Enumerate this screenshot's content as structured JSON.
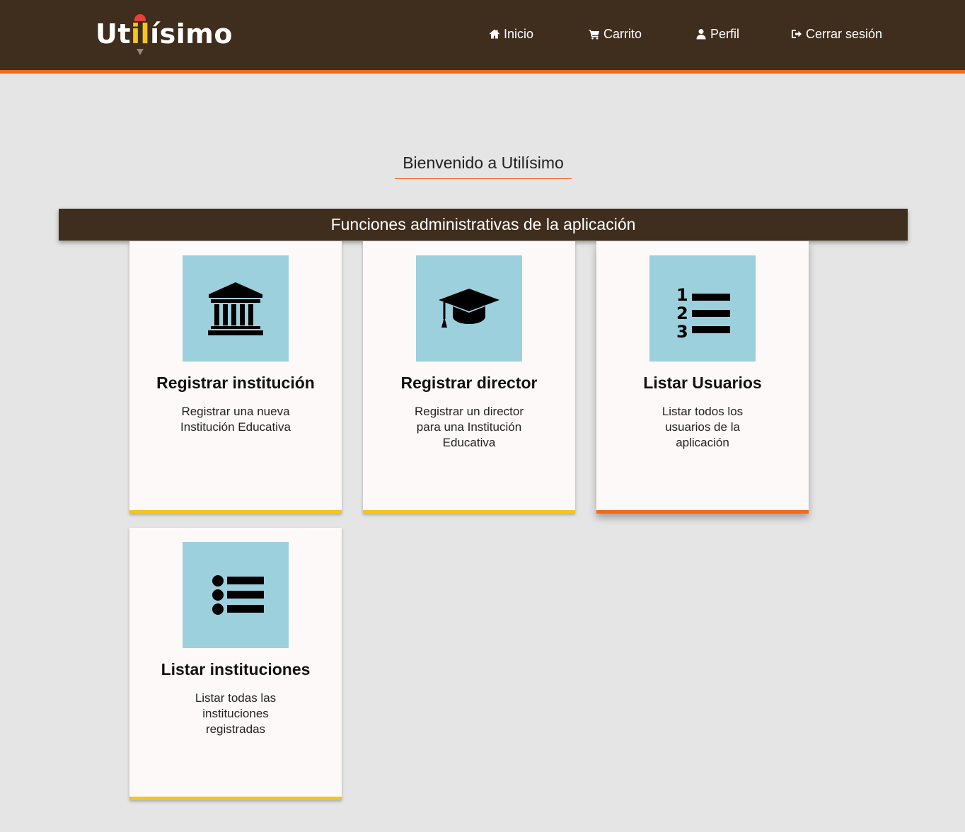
{
  "header": {
    "logo": {
      "part1": "Ut",
      "part2": "il",
      "part3": "ísimo"
    },
    "nav": [
      {
        "label": "Inicio",
        "icon": "home-icon"
      },
      {
        "label": "Carrito",
        "icon": "cart-icon"
      },
      {
        "label": "Perfil",
        "icon": "user-icon"
      },
      {
        "label": "Cerrar sesión",
        "icon": "sign-out-icon"
      }
    ]
  },
  "main": {
    "welcome": "Bienvenido a Utilísimo",
    "section_title": "Funciones administrativas de la aplicación",
    "cards": [
      {
        "title": "Registrar institución",
        "desc": "Registrar una nueva Institución Educativa",
        "icon": "institution-icon"
      },
      {
        "title": "Registrar director",
        "desc": "Registrar un director para una Institución Educativa",
        "icon": "graduation-cap-icon"
      },
      {
        "title": "Listar Usuarios",
        "desc": "Listar todos los usuarios de la aplicación",
        "icon": "numbered-list-icon"
      },
      {
        "title": "Listar instituciones",
        "desc": "Listar todas las instituciones registradas",
        "icon": "bullet-list-icon"
      }
    ]
  },
  "colors": {
    "header_bg": "#3f2d1d",
    "accent_orange": "#f26a1b",
    "accent_yellow": "#f5c518",
    "icon_box_bg": "#9dd0dd",
    "page_bg": "#e5e5e5"
  }
}
